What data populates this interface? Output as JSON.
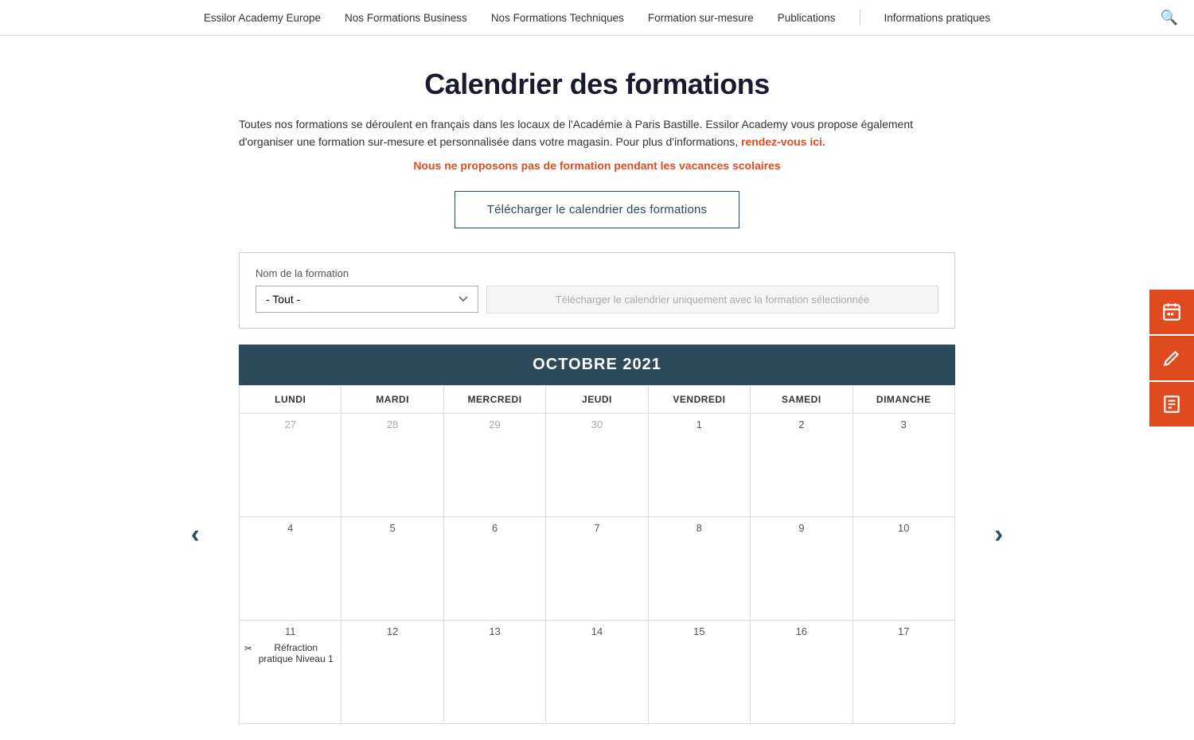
{
  "nav": {
    "items": [
      {
        "label": "Essilor Academy Europe",
        "id": "nav-essilor-academy"
      },
      {
        "label": "Nos Formations Business",
        "id": "nav-formations-business"
      },
      {
        "label": "Nos Formations Techniques",
        "id": "nav-formations-techniques"
      },
      {
        "label": "Formation sur-mesure",
        "id": "nav-formation-sur-mesure"
      },
      {
        "label": "Publications",
        "id": "nav-publications"
      },
      {
        "label": "Informations pratiques",
        "id": "nav-informations-pratiques"
      }
    ],
    "search_icon": "🔍"
  },
  "page": {
    "title": "Calendrier des formations",
    "description_part1": "Toutes nos formations se déroulent en français dans les locaux de l'Académie à Paris Bastille. Essilor Academy vous propose également d'organiser une formation sur-mesure et personnalisée dans votre magasin. Pour plus d'informations,",
    "description_link": "rendez-vous ici.",
    "holiday_notice": "Nous ne proposons pas de formation pendant les vacances scolaires",
    "download_btn_label": "Télécharger le calendrier des formations"
  },
  "filter": {
    "label": "Nom de la formation",
    "select_default": "- Tout -",
    "select_options": [
      "- Tout -"
    ],
    "download_placeholder": "Télécharger le calendrier uniquement avec la formation sélectionnée"
  },
  "calendar": {
    "month_label": "OCTOBRE 2021",
    "days_of_week": [
      "LUNDI",
      "MARDI",
      "MERCREDI",
      "JEUDI",
      "VENDREDI",
      "SAMEDI",
      "DIMANCHE"
    ],
    "weeks": [
      {
        "days": [
          {
            "number": "27",
            "current": false,
            "events": []
          },
          {
            "number": "28",
            "current": false,
            "events": []
          },
          {
            "number": "29",
            "current": false,
            "events": []
          },
          {
            "number": "30",
            "current": false,
            "events": []
          },
          {
            "number": "1",
            "current": true,
            "events": []
          },
          {
            "number": "2",
            "current": true,
            "events": []
          },
          {
            "number": "3",
            "current": true,
            "events": []
          }
        ]
      },
      {
        "days": [
          {
            "number": "4",
            "current": true,
            "events": []
          },
          {
            "number": "5",
            "current": true,
            "events": []
          },
          {
            "number": "6",
            "current": true,
            "events": []
          },
          {
            "number": "7",
            "current": true,
            "events": []
          },
          {
            "number": "8",
            "current": true,
            "events": []
          },
          {
            "number": "9",
            "current": true,
            "events": []
          },
          {
            "number": "10",
            "current": true,
            "events": []
          }
        ]
      },
      {
        "days": [
          {
            "number": "11",
            "current": true,
            "events": [
              {
                "icon": "✂",
                "text": "Réfraction pratique Niveau 1"
              }
            ]
          },
          {
            "number": "12",
            "current": true,
            "events": []
          },
          {
            "number": "13",
            "current": true,
            "events": []
          },
          {
            "number": "14",
            "current": true,
            "events": []
          },
          {
            "number": "15",
            "current": true,
            "events": []
          },
          {
            "number": "16",
            "current": true,
            "events": []
          },
          {
            "number": "17",
            "current": true,
            "events": []
          }
        ]
      }
    ],
    "nav_left": "‹",
    "nav_right": "›"
  },
  "sidebar": {
    "buttons": [
      {
        "icon": "📅",
        "id": "sidebar-calendar"
      },
      {
        "icon": "✏",
        "id": "sidebar-edit"
      },
      {
        "icon": "📋",
        "id": "sidebar-form"
      }
    ]
  }
}
